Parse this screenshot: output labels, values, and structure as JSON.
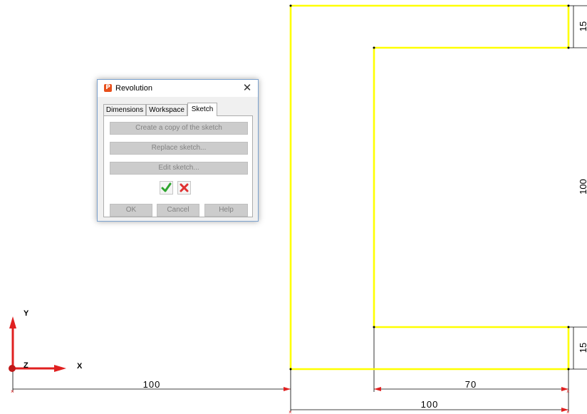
{
  "dialog": {
    "title": "Revolution",
    "app_icon_glyph": "P",
    "close_glyph": "✕",
    "tabs": [
      {
        "label": "Dimensions",
        "active": false
      },
      {
        "label": "Workspace",
        "active": false
      },
      {
        "label": "Sketch",
        "active": true
      }
    ],
    "panel_buttons": {
      "copy": "Create a copy of the sketch",
      "replace": "Replace sketch...",
      "edit": "Edit sketch..."
    },
    "accept_icon": "checkmark-icon",
    "reject_icon": "cross-icon",
    "footer": {
      "ok": "OK",
      "cancel": "Cancel",
      "help": "Help"
    }
  },
  "axes": {
    "y": "Y",
    "z": "Z",
    "x": "X"
  },
  "dimensions": {
    "top_thickness": "15",
    "height": "100",
    "bottom_thickness": "15",
    "origin_offset": "100",
    "inner_width": "70",
    "outer_width": "100"
  },
  "colors": {
    "profile": "#ffff00",
    "axis": "#e02020",
    "dialog_border": "#7da2ce"
  }
}
